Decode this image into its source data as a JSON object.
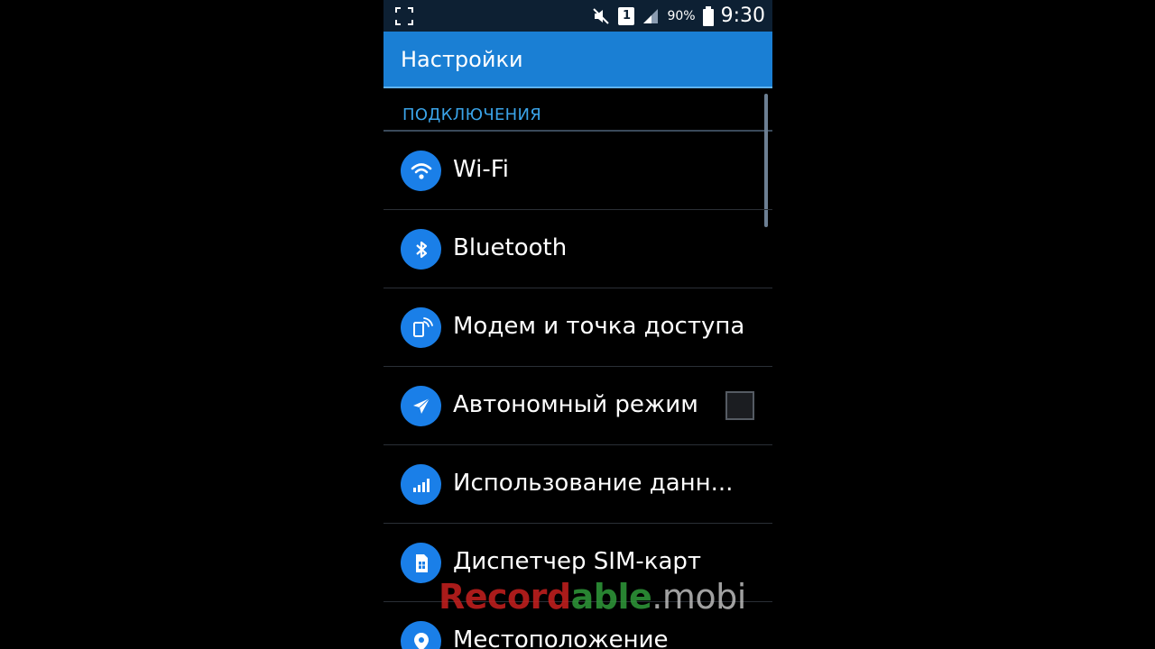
{
  "status_bar": {
    "sim_slot": "1",
    "battery_percent": "90%",
    "time": "9:30"
  },
  "action_bar": {
    "title": "Настройки"
  },
  "section": {
    "header": "ПОДКЛЮЧЕНИЯ"
  },
  "items": [
    {
      "label": "Wi-Fi",
      "icon": "wifi-icon"
    },
    {
      "label": "Bluetooth",
      "icon": "bluetooth-icon"
    },
    {
      "label": "Модем и точка доступа",
      "icon": "hotspot-icon"
    },
    {
      "label": "Автономный режим",
      "icon": "airplane-icon",
      "checked": false
    },
    {
      "label": "Использование данн...",
      "icon": "data-usage-icon"
    },
    {
      "label": "Диспетчер SIM-карт",
      "icon": "sim-card-icon"
    },
    {
      "label": "Местоположение",
      "icon": "location-icon"
    }
  ],
  "watermark": {
    "part1": "Record",
    "part2": "able",
    "part3": ".mobi"
  },
  "colors": {
    "accent": "#1a7fd4",
    "section_header": "#3aa3e8",
    "icon_bg": "#1a7fe8",
    "status_bar_bg": "#0d2033"
  }
}
